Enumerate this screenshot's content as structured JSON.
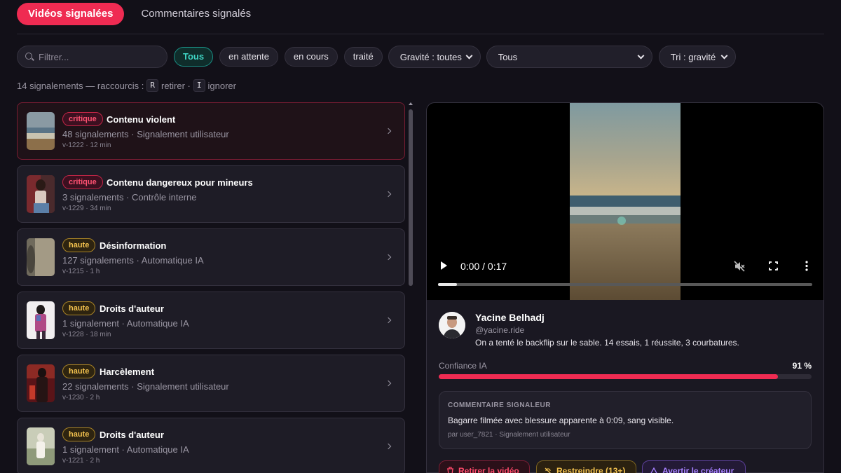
{
  "tabs": [
    {
      "label": "Vidéos signalées",
      "active": true
    },
    {
      "label": "Commentaires signalés",
      "active": false
    }
  ],
  "filters": {
    "search_placeholder": "Filtrer...",
    "status_chips": [
      "Tous",
      "en attente",
      "en cours",
      "traité"
    ],
    "active_chip": "Tous",
    "gravity_select": "Gravité : toutes",
    "type_select": "Tous",
    "sort_select": "Tri : gravité"
  },
  "summary": {
    "count_text": "14 signalements — raccourcis :",
    "key_remove": "R",
    "remove_text": "retirer ·",
    "key_ignore": "I",
    "ignore_text": "ignorer"
  },
  "reports": [
    {
      "severity": "critique",
      "title": "Contenu violent",
      "meta": "48 signalements · Signalement utilisateur",
      "sub": "v-1222 · 12 min",
      "selected": true,
      "thumb": "beach"
    },
    {
      "severity": "critique",
      "title": "Contenu dangereux pour mineurs",
      "meta": "3 signalements · Contrôle interne",
      "sub": "v-1229 · 34 min",
      "selected": false,
      "thumb": "woman-red"
    },
    {
      "severity": "haute",
      "title": "Désinformation",
      "meta": "127 signalements · Automatique IA",
      "sub": "v-1215 · 1 h",
      "selected": false,
      "thumb": "beige"
    },
    {
      "severity": "haute",
      "title": "Droits d'auteur",
      "meta": "1 signalement · Automatique IA",
      "sub": "v-1228 · 18 min",
      "selected": false,
      "thumb": "woman-pink"
    },
    {
      "severity": "haute",
      "title": "Harcèlement",
      "meta": "22 signalements · Signalement utilisateur",
      "sub": "v-1230 · 2 h",
      "selected": false,
      "thumb": "woman-dark"
    },
    {
      "severity": "haute",
      "title": "Droits d'auteur",
      "meta": "1 signalement · Automatique IA",
      "sub": "v-1221 · 2 h",
      "selected": false,
      "thumb": "light"
    }
  ],
  "player": {
    "time": "0:00 / 0:17",
    "progress": 0.05
  },
  "author": {
    "name": "Yacine Belhadj",
    "handle": "@yacine.ride",
    "caption": "On a tenté le backflip sur le sable. 14 essais, 1 réussite, 3 courbatures."
  },
  "confidence": {
    "label": "Confiance IA",
    "value_text": "91 %",
    "value": 0.91
  },
  "comment": {
    "heading": "COMMENTAIRE SIGNALEUR",
    "text": "Bagarre filmée avec blessure apparente à 0:09, sang visible.",
    "by": "par user_7821 · Signalement utilisateur"
  },
  "actions": {
    "remove": "Retirer la vidéo",
    "restrict": "Restreindre (13+)",
    "warn": "Avertir le créateur"
  },
  "colors": {
    "accent": "#ef2b52",
    "critique": "#ff5272",
    "haute": "#f2c14e",
    "active_chip": "#3fd5c4"
  }
}
